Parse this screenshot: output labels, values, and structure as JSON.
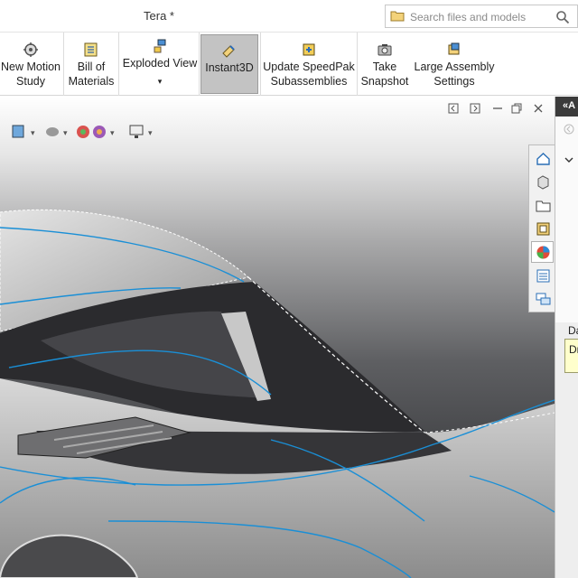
{
  "window": {
    "title": "Tera *"
  },
  "search": {
    "placeholder": "Search files and models",
    "icons": [
      "folder-icon",
      "search-icon"
    ]
  },
  "ribbon": {
    "buttons": [
      {
        "key": "new_motion_study",
        "label": "New Motion\nStudy",
        "icon": "motion-study-icon"
      },
      {
        "key": "bill_of_materials",
        "label": "Bill of\nMaterials",
        "icon": "bom-icon"
      },
      {
        "key": "exploded_view",
        "label": "Exploded View",
        "icon": "exploded-view-icon",
        "has_dropdown": true
      },
      {
        "key": "instant3d",
        "label": "Instant3D",
        "icon": "instant3d-icon",
        "active": true
      },
      {
        "key": "update_speedpak",
        "label": "Update SpeedPak\nSubassemblies",
        "icon": "speedpak-icon"
      },
      {
        "key": "take_snapshot",
        "label": "Take\nSnapshot",
        "icon": "camera-icon"
      },
      {
        "key": "large_assembly",
        "label": "Large Assembly\nSettings",
        "icon": "large-assembly-icon"
      }
    ],
    "dropdown_caret": "▾"
  },
  "viewport": {
    "heads_up_icons": [
      "view-orientation-icon",
      "hide-show-icon",
      "edit-appearance-icon",
      "scene-icon",
      "display-monitor-icon"
    ],
    "window_controls": [
      "restore-icon",
      "tile-icon",
      "maximize-icon",
      "close-icon"
    ],
    "accent_color": "#1a8fd6"
  },
  "task_pane": {
    "tabs": [
      "home-icon",
      "design-library-icon",
      "file-explorer-icon",
      "view-palette-icon",
      "appearances-icon",
      "custom-properties-icon",
      "forum-icon"
    ],
    "selected": "appearances-icon"
  },
  "right_panel": {
    "header": "«A",
    "label": "Da",
    "note": "Dr"
  }
}
